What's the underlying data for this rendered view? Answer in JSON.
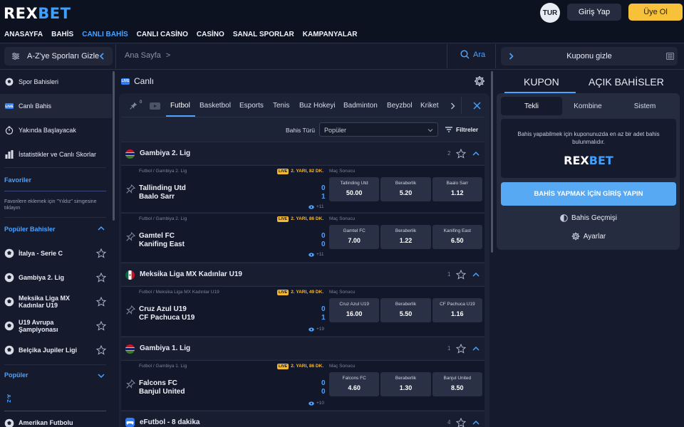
{
  "brand": {
    "prefix": "REX",
    "suffix": "BET"
  },
  "header": {
    "lang": "TUR",
    "login": "Giriş Yap",
    "register": "Üye Ol"
  },
  "nav": [
    "ANASAYFA",
    "BAHİS",
    "CANLI BAHİS",
    "CANLI CASİNO",
    "CASİNO",
    "SANAL SPORLAR",
    "KAMPANYALAR"
  ],
  "subbar": {
    "az_label": "A-Z'ye Sporları Gizle",
    "breadcrumb": "Ana Sayfa",
    "breadcrumb_sep": ">",
    "search": "Ara",
    "coupon_toggle": "Kuponu gizle"
  },
  "sidebar": {
    "items": [
      "Spor Bahisleri",
      "Canlı Bahis",
      "Yakında Başlayacak",
      "İstatistikler ve Canlı Skorlar"
    ],
    "favorites_title": "Favoriler",
    "favorites_note": "Favorilere eklemek için \"Yıldız\" simgesine tıklayın",
    "popular_title": "Popüler Bahisler",
    "popular": [
      "İtalya - Serie C",
      "Gambiya 2. Lig",
      "Meksika Liga MX Kadınlar U19",
      "U19 Avrupa Şampiyonası",
      "Belçika Jupiler Ligi"
    ],
    "popular2_title": "Popüler",
    "az_vertical": "A-Z",
    "bottom_item": "Amerikan Futbolu"
  },
  "main": {
    "title": "Canlı",
    "live_badge": "LIVE",
    "pin_count": "0",
    "tabs": [
      "Futbol",
      "Basketbol",
      "Esports",
      "Tenis",
      "Buz Hokeyi",
      "Badminton",
      "Beyzbol",
      "Kriket"
    ],
    "bet_type_label": "Bahis Türü",
    "bet_type_value": "Popüler",
    "filters": "Filtreler"
  },
  "leagues": [
    {
      "name": "Gambiya 2. Lig",
      "count": "2"
    },
    {
      "name": "Meksika Liga MX Kadınlar U19",
      "count": "1"
    },
    {
      "name": "Gambiya 1. Lig",
      "count": "1"
    },
    {
      "name": "eFutbol - 8 dakika",
      "count": "4"
    }
  ],
  "matches": [
    {
      "path": "Futbol / Gambiya 2. Lig",
      "live": "LIVE",
      "period": "2. YARI, 82 DK.",
      "market": "Maç Sonucu",
      "home": "Tallinding Utd",
      "away": "Baalo Sarr",
      "score_home": "0",
      "score_away": "1",
      "more": "+11",
      "odds": [
        {
          "name": "Tallinding Utd",
          "value": "50.00"
        },
        {
          "name": "Beraberlik",
          "value": "5.20"
        },
        {
          "name": "Baalo Sarr",
          "value": "1.12"
        }
      ]
    },
    {
      "path": "Futbol / Gambiya 2. Lig",
      "live": "LIVE",
      "period": "2. YARI, 86 DK.",
      "market": "Maç Sonucu",
      "home": "Gamtel FC",
      "away": "Kanifing East",
      "score_home": "0",
      "score_away": "0",
      "more": "+11",
      "odds": [
        {
          "name": "Gamtel FC",
          "value": "7.00"
        },
        {
          "name": "Beraberlik",
          "value": "1.22"
        },
        {
          "name": "Kanifing East",
          "value": "6.50"
        }
      ]
    },
    {
      "path": "Futbol / Meksika Liga MX Kadınlar U19",
      "live": "LIVE",
      "period": "2. YARI, 49 DK.",
      "market": "Maç Sonucu",
      "home": "Cruz Azul U19",
      "away": "CF Pachuca U19",
      "score_home": "0",
      "score_away": "1",
      "more": "+19",
      "odds": [
        {
          "name": "Cruz Azul U19",
          "value": "16.00"
        },
        {
          "name": "Beraberlik",
          "value": "5.50"
        },
        {
          "name": "CF Pachuca U19",
          "value": "1.16"
        }
      ]
    },
    {
      "path": "Futbol / Gambiya 1. Lig",
      "live": "LIVE",
      "period": "2. YARI, 86 DK.",
      "market": "Maç Sonucu",
      "home": "Falcons FC",
      "away": "Banjul United",
      "score_home": "0",
      "score_away": "0",
      "more": "+10",
      "odds": [
        {
          "name": "Falcons FC",
          "value": "4.60"
        },
        {
          "name": "Beraberlik",
          "value": "1.30"
        },
        {
          "name": "Banjul United",
          "value": "8.50"
        }
      ]
    }
  ],
  "coupon": {
    "tabs": [
      "KUPON",
      "AÇIK BAHİSLER"
    ],
    "subtabs": [
      "Tekli",
      "Kombine",
      "Sistem"
    ],
    "empty_text": "Bahis yapabilmek için kuponunuzda en az bir adet bahis bulunmalıdır.",
    "cta": "BAHİS YAPMAK İÇİN GİRİŞ YAPIN",
    "history": "Bahis Geçmişi",
    "settings": "Ayarlar"
  },
  "colors": {
    "accent": "#4aa3ff",
    "register": "#f7c23a",
    "live_tag": "#f3b935",
    "bg": "#151a2c"
  }
}
